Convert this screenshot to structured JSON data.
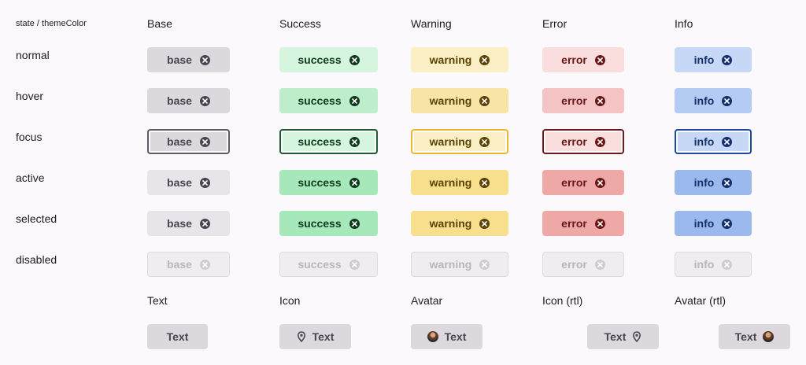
{
  "corner_label": "state / themeColor",
  "columns": [
    {
      "key": "base",
      "header": "Base",
      "label": "base"
    },
    {
      "key": "success",
      "header": "Success",
      "label": "success"
    },
    {
      "key": "warning",
      "header": "Warning",
      "label": "warning"
    },
    {
      "key": "error",
      "header": "Error",
      "label": "error"
    },
    {
      "key": "info",
      "header": "Info",
      "label": "info"
    }
  ],
  "states": [
    "normal",
    "hover",
    "focus",
    "active",
    "selected",
    "disabled"
  ],
  "close_icon": "close-circle-icon",
  "variants": {
    "headers": [
      "Text",
      "Icon",
      "Avatar",
      "Icon (rtl)",
      "Avatar (rtl)"
    ],
    "chip_text": "Text",
    "icons": {
      "icon": "map-pin-icon",
      "avatar": "avatar-icon"
    }
  },
  "colors": {
    "background": "#fcf9fc",
    "base": "#dcd8de",
    "success": "#bdedcb",
    "warning": "#f8e4a6",
    "error": "#f3c4c3",
    "info": "#b4cbf4"
  }
}
